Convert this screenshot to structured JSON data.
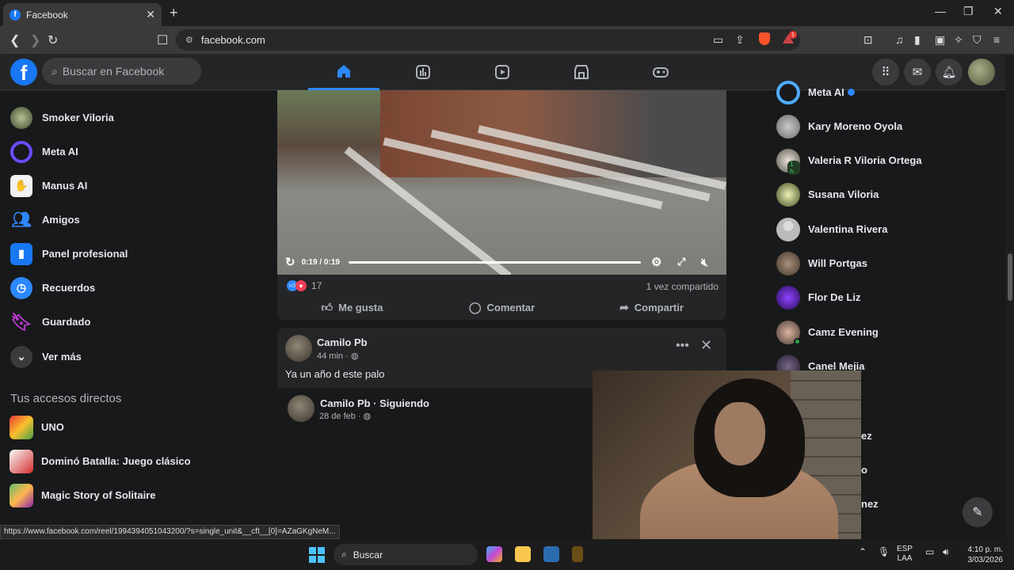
{
  "browser": {
    "tab_title": "Facebook",
    "url": "facebook.com",
    "rewards_badge": "1",
    "status_url": "https://www.facebook.com/reel/1994394051043200/?s=single_unit&__cft__[0]=AZaGKgNeM..."
  },
  "fb": {
    "search_placeholder": "Buscar en Facebook",
    "nav_tabs": [
      "home-icon",
      "dashboard-icon",
      "video-icon",
      "marketplace-icon",
      "gaming-icon"
    ],
    "accent_color": "#2d88ff"
  },
  "left_nav": {
    "items": [
      {
        "label": "Smoker Viloria",
        "icon": "avatar"
      },
      {
        "label": "Meta AI",
        "icon": "meta-ai-icon"
      },
      {
        "label": "Manus AI",
        "icon": "manus-icon"
      },
      {
        "label": "Amigos",
        "icon": "friends-icon"
      },
      {
        "label": "Panel profesional",
        "icon": "dashboard-icon"
      },
      {
        "label": "Recuerdos",
        "icon": "clock-icon"
      },
      {
        "label": "Guardado",
        "icon": "bookmark-icon"
      },
      {
        "label": "Ver más",
        "icon": "chevron-down-icon"
      }
    ],
    "shortcuts_title": "Tus accesos directos",
    "shortcuts": [
      {
        "label": "UNO"
      },
      {
        "label": "Dominó Batalla: Juego clásico"
      },
      {
        "label": "Magic Story of Solitaire"
      }
    ]
  },
  "post1": {
    "video_time": "0:19 / 0:19",
    "progress": 1.0,
    "reaction_count": "17",
    "shares": "1 vez compartido",
    "like_label": "Me gusta",
    "comment_label": "Comentar",
    "share_label": "Compartir"
  },
  "post2": {
    "author": "Camilo Pb",
    "time": "44 min ·",
    "text": "Ya un año d este palo",
    "shared_author": "Camilo Pb · Siguiendo",
    "shared_time": "28 de feb ·"
  },
  "contacts": [
    {
      "name": "Meta AI",
      "verified": true
    },
    {
      "name": "Kary Moreno Oyola"
    },
    {
      "name": "Valeria R Viloria Ortega",
      "away": "1 h"
    },
    {
      "name": "Susana Viloria"
    },
    {
      "name": "Valentina Rivera"
    },
    {
      "name": "Will Portgas"
    },
    {
      "name": "Flor De Liz"
    },
    {
      "name": "Camz Evening",
      "online": true
    },
    {
      "name": "Canel Mejia"
    }
  ],
  "contacts_partial": [
    "ez",
    "o",
    "nez"
  ],
  "taskbar": {
    "search_placeholder": "Buscar",
    "lang_top": "ESP",
    "lang_bottom": "LAA",
    "time": "4:10 p. m.",
    "date": "3/03/2026"
  }
}
